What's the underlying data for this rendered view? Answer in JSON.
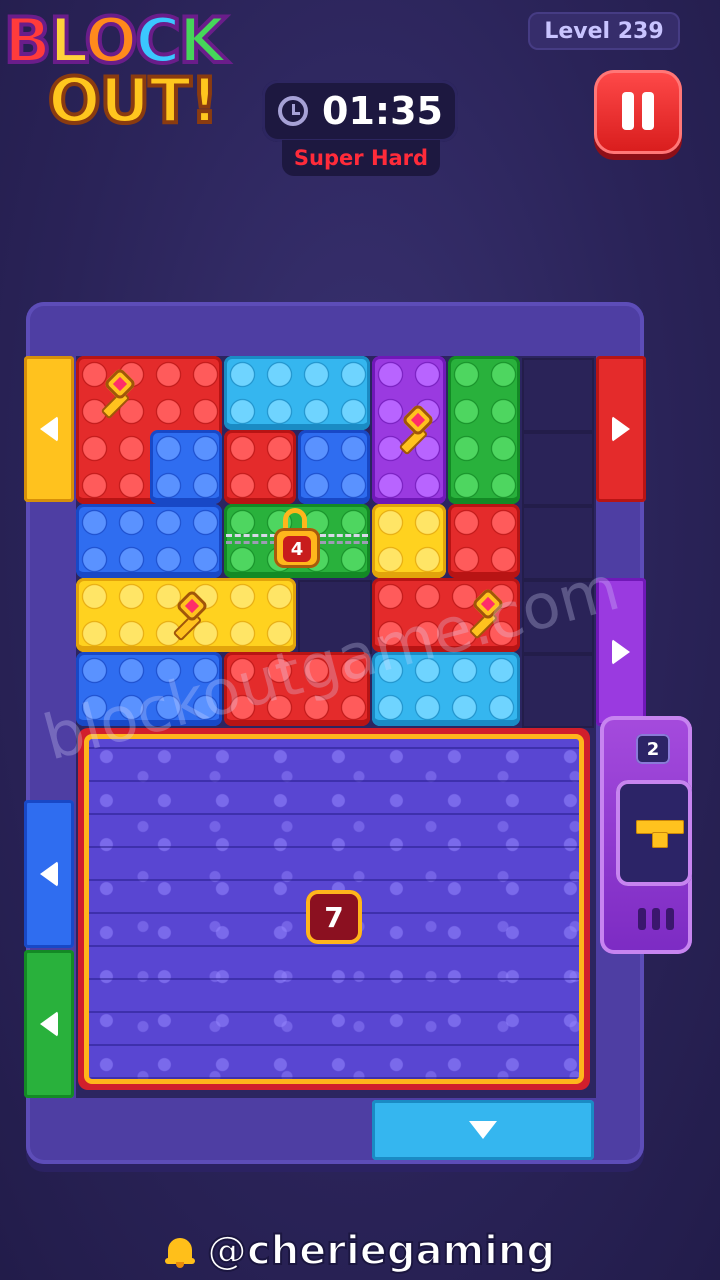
{
  "header": {
    "logo": {
      "line1": [
        "B",
        "L",
        "O",
        "C",
        "K"
      ],
      "line2": "OUT!"
    },
    "level_label": "Level 239",
    "timer": "01:35",
    "difficulty": "Super Hard"
  },
  "board": {
    "lock_count": "4",
    "frozen_counter": "7"
  },
  "dispenser": {
    "count": "2"
  },
  "watermark": "blockoutgame.com",
  "footer": {
    "handle": "@cheriegaming"
  },
  "colors": {
    "background": "#2a2358",
    "frame": "#4e3ea3",
    "timer_text": "#ffffff",
    "difficulty_text": "#ff2b3a",
    "pause_button": "#e82525"
  }
}
